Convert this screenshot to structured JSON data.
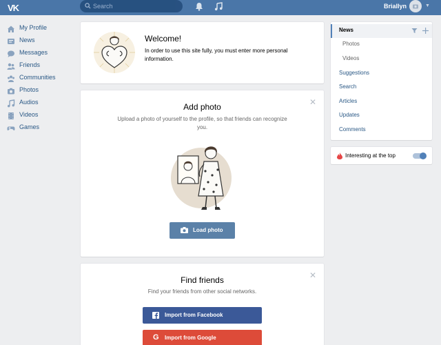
{
  "header": {
    "logo": "VK",
    "search_placeholder": "Search",
    "user_name": "Briallyn"
  },
  "sidebar": {
    "items": [
      {
        "label": "My Profile",
        "icon": "home-icon"
      },
      {
        "label": "News",
        "icon": "news-icon"
      },
      {
        "label": "Messages",
        "icon": "messages-icon"
      },
      {
        "label": "Friends",
        "icon": "friends-icon"
      },
      {
        "label": "Communities",
        "icon": "communities-icon"
      },
      {
        "label": "Photos",
        "icon": "camera-icon"
      },
      {
        "label": "Audios",
        "icon": "music-icon"
      },
      {
        "label": "Videos",
        "icon": "video-icon"
      },
      {
        "label": "Games",
        "icon": "gamepad-icon"
      }
    ]
  },
  "welcome": {
    "title": "Welcome!",
    "text": "In order to use this site fully, you must enter more personal information."
  },
  "add_photo": {
    "title": "Add photo",
    "subtitle": "Upload a photo of yourself to the profile, so that friends can recognize you.",
    "button": "Load photo"
  },
  "find_friends": {
    "title": "Find friends",
    "subtitle": "Find your friends from other social networks.",
    "facebook_button": "Import from Facebook",
    "google_button": "Import from Google"
  },
  "right_nav": {
    "active": "News",
    "items": [
      "Photos",
      "Videos",
      "Suggestions",
      "Search",
      "Articles",
      "Updates",
      "Comments"
    ]
  },
  "interesting": {
    "label": "Interesting at the top",
    "enabled": true
  },
  "colors": {
    "header": "#4a76a8",
    "link": "#2a5885",
    "facebook": "#3b5998",
    "google": "#dd4b39"
  }
}
